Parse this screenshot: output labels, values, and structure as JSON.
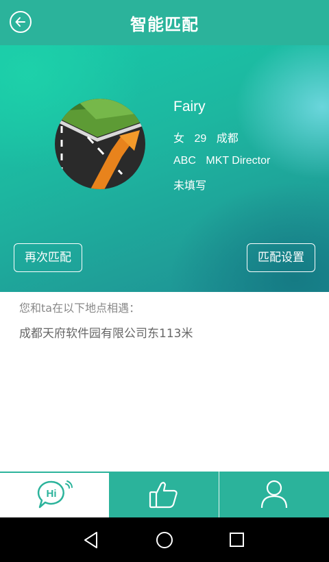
{
  "header": {
    "title": "智能匹配"
  },
  "profile": {
    "name": "Fairy",
    "gender": "女",
    "age": "29",
    "city": "成都",
    "company": "ABC",
    "position": "MKT Director",
    "note": "未填写"
  },
  "actions": {
    "rematch": "再次匹配",
    "settings": "匹配设置"
  },
  "meet": {
    "label": "您和ta在以下地点相遇：",
    "place": "成都天府软件园有限公司东113米"
  },
  "tabs": {
    "hi_text": "Hi"
  },
  "colors": {
    "accent": "#2bb39b"
  },
  "icons": [
    "back-arrow-icon",
    "hi-chat-icon",
    "thumbs-up-icon",
    "user-icon",
    "nav-back-icon",
    "nav-home-icon",
    "nav-recent-icon"
  ]
}
